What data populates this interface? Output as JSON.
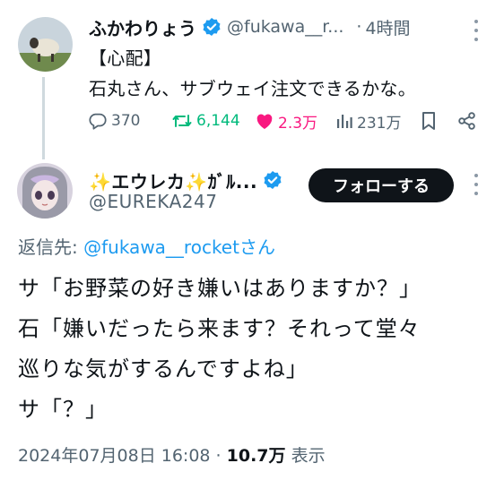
{
  "parent_tweet": {
    "author_name": "ふかわりょう",
    "handle": "@fukawa__r...",
    "separator": "·",
    "time": "4時間",
    "text": "【心配】\n石丸さん、サブウェイ注文できるかな。",
    "stats": {
      "replies": "370",
      "retweets": "6,144",
      "likes": "2.3万",
      "views": "231万"
    }
  },
  "reply_tweet": {
    "author_name": "✨エウレカ✨ｶﾞﾙ...",
    "handle": "@EUREKA247",
    "follow_label": "フォローする",
    "reply_to_prefix": "返信先: ",
    "reply_to_mention": "@fukawa__rocket",
    "reply_to_suffix": "さん",
    "lines": [
      "サ「お野菜の好き嫌いはありますか？」",
      "石「嫌いだったら来ます？それって堂々",
      "巡りな気がするんですよね」",
      "サ「？」"
    ],
    "timestamp": "2024年07月08日 16:08",
    "meta_separator": " · ",
    "views": "10.7万",
    "views_label": " 表示"
  },
  "colors": {
    "verified": "#1d9bf0",
    "retweet": "#00ba7c",
    "like": "#f91880",
    "muted": "#536471",
    "link": "#1d9bf0",
    "follow_bg": "#0f1419"
  }
}
